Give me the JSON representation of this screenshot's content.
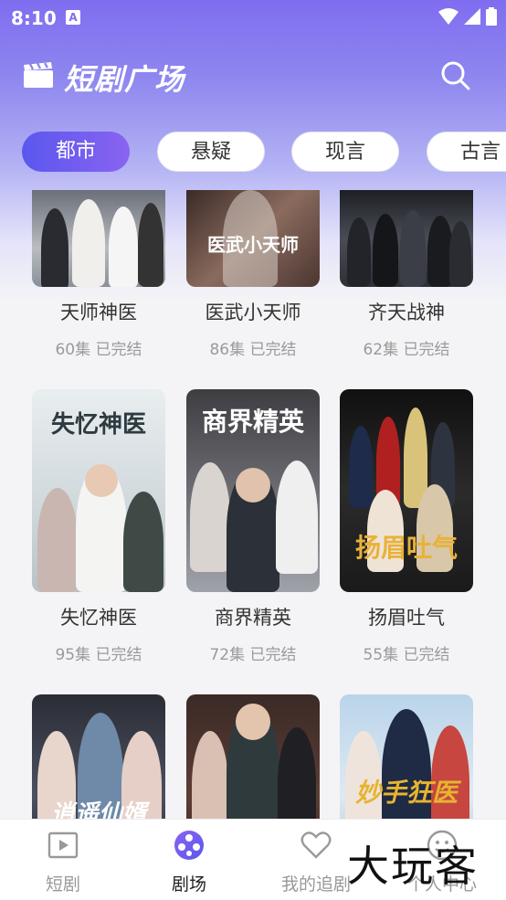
{
  "status": {
    "time": "8:10",
    "a_icon": "A"
  },
  "header": {
    "title": "短剧广场",
    "icon": "clapperboard-icon",
    "search_icon": "search-icon"
  },
  "tabs": [
    {
      "label": "都市",
      "active": true
    },
    {
      "label": "悬疑",
      "active": false
    },
    {
      "label": "现言",
      "active": false
    },
    {
      "label": "古言",
      "active": false
    }
  ],
  "dramas": [
    {
      "name": "天师神医",
      "meta": "60集 已完结",
      "poster_text": ""
    },
    {
      "name": "医武小天师",
      "meta": "86集 已完结",
      "poster_text": "医武小天师"
    },
    {
      "name": "齐天战神",
      "meta": "62集 已完结",
      "poster_text": ""
    },
    {
      "name": "失忆神医",
      "meta": "95集 已完结",
      "poster_text": "失忆神医"
    },
    {
      "name": "商界精英",
      "meta": "72集 已完结",
      "poster_text": "商界精英"
    },
    {
      "name": "扬眉吐气",
      "meta": "55集 已完结",
      "poster_text": "扬眉吐气"
    },
    {
      "name": "",
      "meta": "",
      "poster_text": "逍遥仙婿"
    },
    {
      "name": "",
      "meta": "",
      "poster_text": ""
    },
    {
      "name": "",
      "meta": "",
      "poster_text": "妙手狂医"
    }
  ],
  "nav": [
    {
      "label": "短剧",
      "icon": "play-icon",
      "active": false
    },
    {
      "label": "剧场",
      "icon": "theater-icon",
      "active": true
    },
    {
      "label": "我的追剧",
      "icon": "heart-icon",
      "active": false
    },
    {
      "label": "个人中心",
      "icon": "smile-icon",
      "active": false
    }
  ],
  "watermark": "大玩客",
  "colors": {
    "accent": "#5a57ee",
    "header_gradient_top": "#7f6df0"
  }
}
